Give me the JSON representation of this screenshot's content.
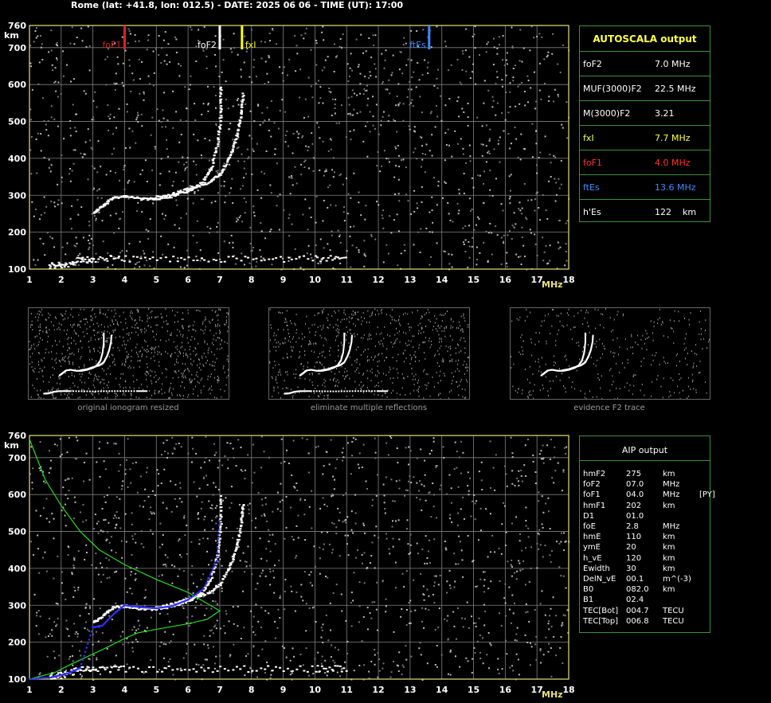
{
  "header": "Rome (lat: +41.8, lon: 012.5) - DATE: 2025 06 06 - TIME (UT): 17:00",
  "colors": {
    "axis": "#e8e07a",
    "grid": "#808080",
    "fof1": "#e02020",
    "fof2": "#ffffff",
    "fxi": "#ffff00",
    "ftes": "#3a8cff",
    "panel_border": "#3c8f3c",
    "profile": "#22dd22",
    "fit": "#3030ff"
  },
  "autoscala": {
    "title": "AUTOSCALA output",
    "rows": [
      {
        "label": "foF2",
        "value": "7.0 MHz",
        "color": "#ffffff"
      },
      {
        "label": "MUF(3000)F2",
        "value": "22.5 MHz",
        "color": "#ffffff"
      },
      {
        "label": "M(3000)F2",
        "value": "3.21",
        "color": "#ffffff"
      },
      {
        "label": "fxI",
        "value": "7.7 MHz",
        "color": "#ffff44"
      },
      {
        "label": "foF1",
        "value": "4.0 MHz",
        "color": "#ff3030"
      },
      {
        "label": "ftEs",
        "value": "13.6 MHz",
        "color": "#3a8cff"
      },
      {
        "label": "h'Es",
        "value": "122    km",
        "color": "#ffffff"
      }
    ]
  },
  "aip": {
    "title": "AIP output",
    "rows": [
      [
        "hmF2",
        "275",
        "km",
        ""
      ],
      [
        "foF2",
        "07.0",
        "MHz",
        ""
      ],
      [
        "foF1",
        "04.0",
        "MHz",
        "[PY]"
      ],
      [
        "hmF1",
        "202",
        "km",
        ""
      ],
      [
        "D1",
        "01.0",
        "",
        ""
      ],
      [
        "foE",
        "2.8",
        "MHz",
        ""
      ],
      [
        "hmE",
        "110",
        "km",
        ""
      ],
      [
        "ymE",
        "20",
        "km",
        ""
      ],
      [
        "h_vE",
        "120",
        "km",
        ""
      ],
      [
        "Ewidth",
        "30",
        "km",
        ""
      ],
      [
        "DelN_vE",
        "00.1",
        "m^(-3)",
        ""
      ],
      [
        "B0",
        "082.0",
        "km",
        ""
      ],
      [
        "B1",
        "02.4",
        "",
        ""
      ],
      [
        "TEC[Bot]",
        "004.7",
        "TECU",
        ""
      ],
      [
        "TEC[Top]",
        "006.8",
        "TECU",
        ""
      ]
    ]
  },
  "captions": [
    "original ionogram resized",
    "eliminate multiple reflections",
    "evidence F2 trace"
  ],
  "chart_data": [
    {
      "type": "scatter",
      "xlabel": "MHz",
      "ylabel": "km",
      "xlim": [
        1,
        18
      ],
      "ylim": [
        100,
        760
      ],
      "x_ticks": [
        1,
        2,
        3,
        4,
        5,
        6,
        7,
        8,
        9,
        10,
        11,
        12,
        13,
        14,
        15,
        16,
        17,
        18
      ],
      "y_ticks": [
        100,
        200,
        300,
        400,
        500,
        600,
        700,
        760
      ],
      "markers": [
        {
          "label": "foF1",
          "x": 4.0,
          "color": "#e02020"
        },
        {
          "label": "foF2",
          "x": 7.0,
          "color": "#ffffff"
        },
        {
          "label": "fxI",
          "x": 7.7,
          "color": "#ffff00"
        },
        {
          "label": "ftEs",
          "x": 13.6,
          "color": "#3a8cff"
        }
      ],
      "traces": [
        {
          "name": "F2 o-trace",
          "points": [
            [
              3.0,
              255
            ],
            [
              3.3,
              275
            ],
            [
              3.6,
              295
            ],
            [
              4.0,
              300
            ],
            [
              4.5,
              292
            ],
            [
              5.0,
              292
            ],
            [
              5.5,
              300
            ],
            [
              6.0,
              315
            ],
            [
              6.4,
              335
            ],
            [
              6.7,
              375
            ],
            [
              6.9,
              440
            ],
            [
              7.0,
              520
            ],
            [
              7.0,
              600
            ]
          ]
        },
        {
          "name": "F2 x-trace",
          "points": [
            [
              4.9,
              296
            ],
            [
              5.5,
              305
            ],
            [
              6.0,
              320
            ],
            [
              6.6,
              335
            ],
            [
              7.0,
              360
            ],
            [
              7.3,
              410
            ],
            [
              7.5,
              460
            ],
            [
              7.65,
              520
            ],
            [
              7.7,
              580
            ]
          ]
        },
        {
          "name": "Es trace",
          "points": [
            [
              1.6,
              110
            ],
            [
              2.0,
              112
            ],
            [
              2.5,
              125
            ],
            [
              3.0,
              130
            ],
            [
              4.0,
              130
            ],
            [
              6.0,
              128
            ],
            [
              8.0,
              130
            ],
            [
              10.0,
              130
            ],
            [
              11.0,
              130
            ]
          ]
        }
      ]
    },
    {
      "type": "line",
      "xlabel": "MHz",
      "ylabel": "km",
      "xlim": [
        1,
        18
      ],
      "ylim": [
        100,
        760
      ],
      "x_ticks": [
        1,
        2,
        3,
        4,
        5,
        6,
        7,
        8,
        9,
        10,
        11,
        12,
        13,
        14,
        15,
        16,
        17,
        18
      ],
      "y_ticks": [
        100,
        200,
        300,
        400,
        500,
        600,
        700,
        760
      ],
      "series": [
        {
          "values": [
            [
              1.0,
              750
            ],
            [
              1.5,
              640
            ],
            [
              2.0,
              570
            ],
            [
              2.6,
              500
            ],
            [
              3.2,
              450
            ],
            [
              4.0,
              410
            ],
            [
              5.0,
              370
            ],
            [
              6.0,
              335
            ],
            [
              6.7,
              300
            ],
            [
              7.0,
              285
            ],
            [
              6.6,
              262
            ],
            [
              6.0,
              250
            ],
            [
              5.0,
              235
            ],
            [
              4.4,
              225
            ],
            [
              4.0,
              210
            ],
            [
              3.3,
              180
            ],
            [
              2.8,
              160
            ],
            [
              2.3,
              140
            ],
            [
              1.8,
              118
            ],
            [
              1.0,
              100
            ]
          ]
        },
        {
          "values": [
            [
              1.0,
              100
            ],
            [
              1.7,
              105
            ],
            [
              2.2,
              115
            ],
            [
              2.6,
              130
            ],
            [
              3.0,
              240
            ],
            [
              3.3,
              245
            ],
            [
              3.7,
              280
            ],
            [
              4.0,
              300
            ],
            [
              4.5,
              295
            ],
            [
              5.0,
              292
            ],
            [
              5.5,
              298
            ],
            [
              6.0,
              315
            ],
            [
              6.5,
              345
            ],
            [
              6.9,
              420
            ],
            [
              7.0,
              540
            ]
          ]
        }
      ]
    }
  ]
}
